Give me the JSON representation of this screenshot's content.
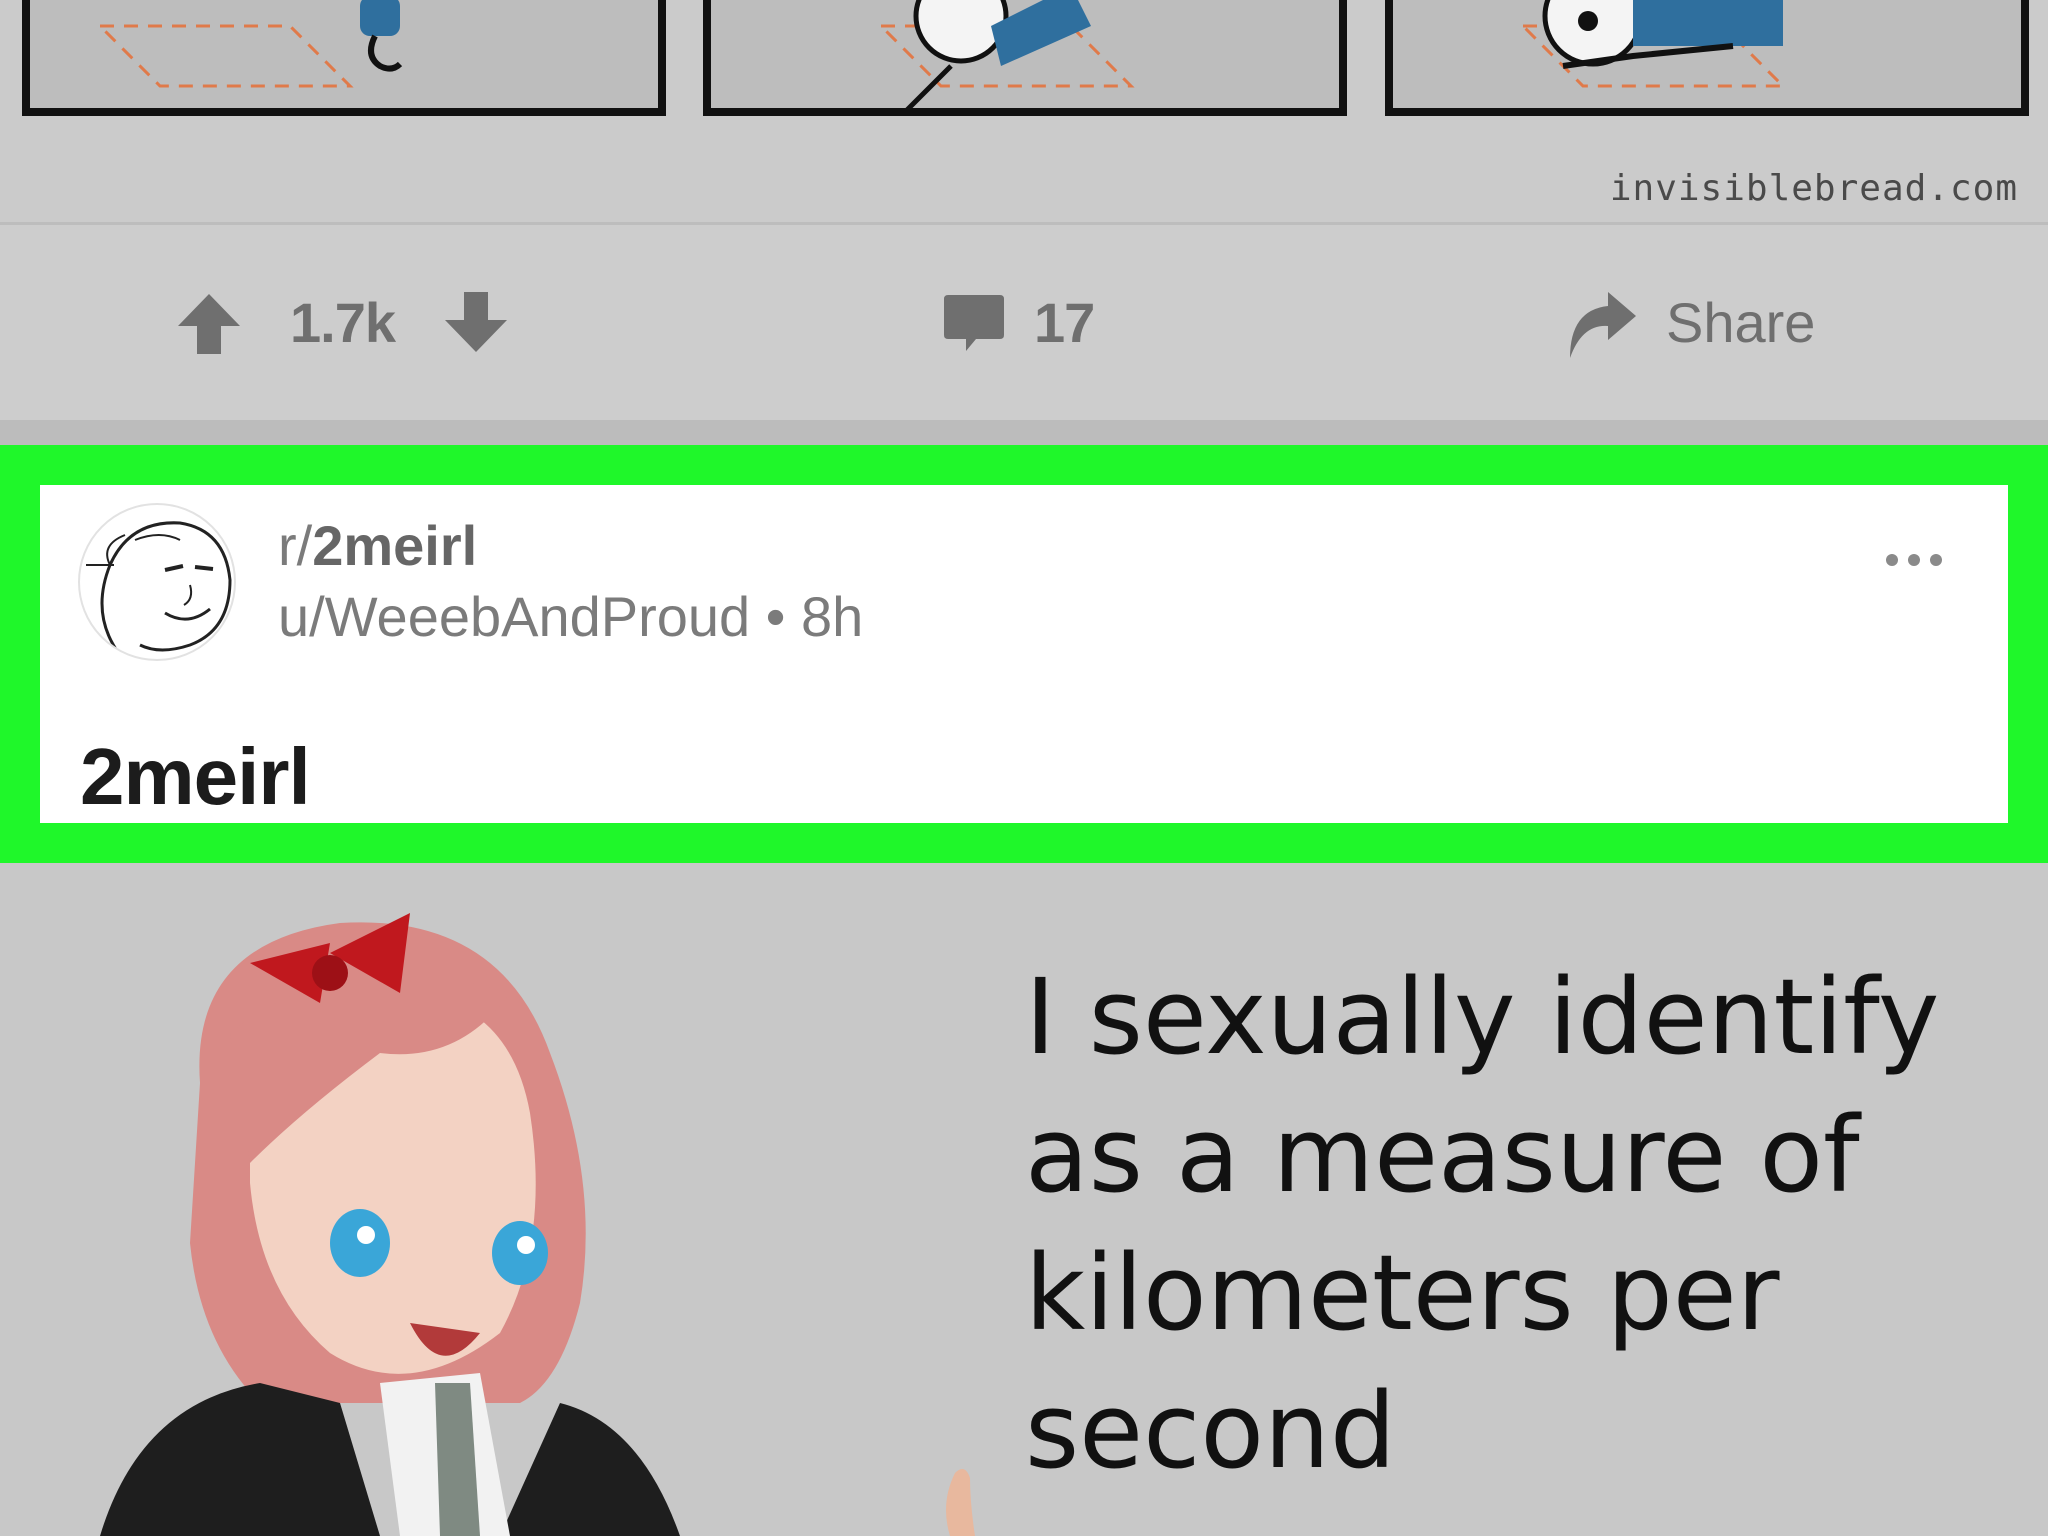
{
  "previous_post": {
    "watermark": "invisiblebread.com",
    "upvotes": "1.7k",
    "comments": "17",
    "share_label": "Share"
  },
  "post": {
    "subreddit_prefix": "r/",
    "subreddit_name": "2meirl",
    "author": "u/WeeebAndProud",
    "separator": "•",
    "age": "8h",
    "title": "2meirl"
  },
  "meme": {
    "lines": [
      "I sexually identify",
      "as a measure of",
      "kilometers per",
      "second"
    ]
  },
  "colors": {
    "highlight": "#1ff72a",
    "dim_background": "#c9c9c9",
    "card": "#ffffff"
  }
}
